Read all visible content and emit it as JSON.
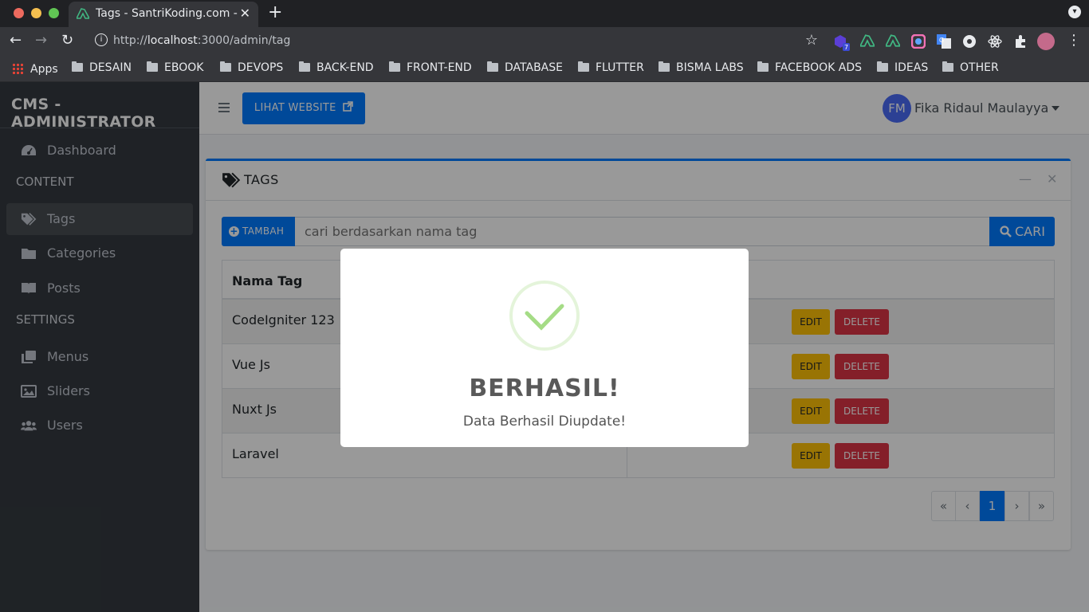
{
  "browser": {
    "tab_title": "Tags - SantriKoding.com - ",
    "url_prefix": "http://",
    "url_host": "localhost",
    "url_rest": ":3000/admin/tag",
    "extension_badge": "7",
    "bookmarks": [
      {
        "label": "Apps",
        "icon": "apps-grid-icon"
      },
      {
        "label": "DESAIN",
        "icon": "folder-icon"
      },
      {
        "label": "EBOOK",
        "icon": "folder-icon"
      },
      {
        "label": "DEVOPS",
        "icon": "folder-icon"
      },
      {
        "label": "BACK-END",
        "icon": "folder-icon"
      },
      {
        "label": "FRONT-END",
        "icon": "folder-icon"
      },
      {
        "label": "DATABASE",
        "icon": "folder-icon"
      },
      {
        "label": "FLUTTER",
        "icon": "folder-icon"
      },
      {
        "label": "BISMA LABS",
        "icon": "folder-icon"
      },
      {
        "label": "FACEBOOK ADS",
        "icon": "folder-icon"
      },
      {
        "label": "IDEAS",
        "icon": "folder-icon"
      },
      {
        "label": "OTHER",
        "icon": "folder-icon"
      }
    ]
  },
  "sidebar": {
    "brand": "CMS - ADMINISTRATOR",
    "items": [
      {
        "label": "Dashboard",
        "icon": "dashboard-icon"
      },
      {
        "label": "Tags",
        "icon": "tags-icon",
        "active": true
      },
      {
        "label": "Categories",
        "icon": "folder-icon"
      },
      {
        "label": "Posts",
        "icon": "book-icon"
      },
      {
        "label": "Menus",
        "icon": "clone-icon"
      },
      {
        "label": "Sliders",
        "icon": "image-icon"
      },
      {
        "label": "Users",
        "icon": "users-icon"
      }
    ],
    "headers": {
      "content": "CONTENT",
      "settings": "SETTINGS"
    }
  },
  "header": {
    "website_button": "LIHAT WEBSITE",
    "avatar_initials": "FM",
    "user_name": "Fika Ridaul Maulayya"
  },
  "card": {
    "title": "TAGS",
    "add_button": "TAMBAH",
    "search_placeholder": "cari berdasarkan nama tag",
    "search_button": "CARI",
    "column_name": "Nama Tag",
    "rows": [
      {
        "name": "CodeIgniter 123"
      },
      {
        "name": "Vue Js"
      },
      {
        "name": "Nuxt Js"
      },
      {
        "name": "Laravel"
      }
    ],
    "edit_label": "EDIT",
    "delete_label": "DELETE",
    "pagination": [
      "«",
      "‹",
      "1",
      "›",
      "»"
    ]
  },
  "modal": {
    "title": "BERHASIL!",
    "text": "Data Berhasil Diupdate!"
  },
  "colors": {
    "primary": "#007bff",
    "warning": "#ffc107",
    "danger": "#dc3545",
    "success_check": "#a5dc86",
    "sidebar_bg": "#343a40"
  }
}
